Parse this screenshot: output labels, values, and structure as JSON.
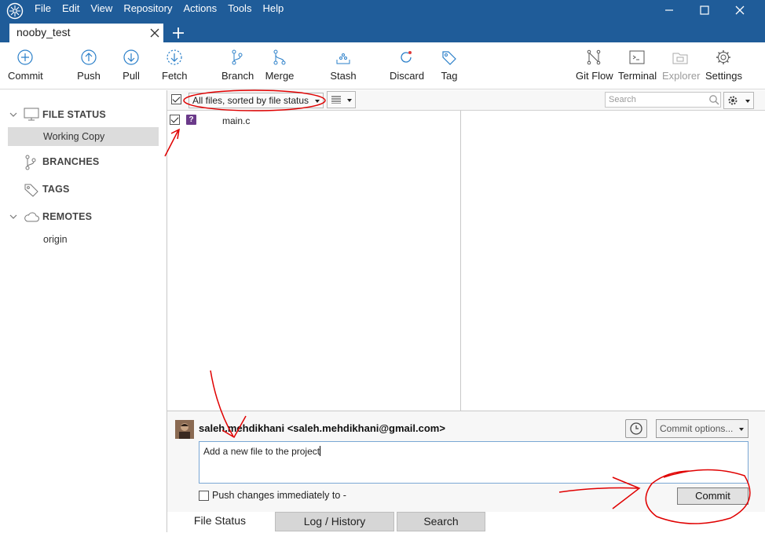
{
  "menu": [
    "File",
    "Edit",
    "View",
    "Repository",
    "Actions",
    "Tools",
    "Help"
  ],
  "tab": {
    "label": "nooby_test"
  },
  "toolbar": {
    "commit": "Commit",
    "push": "Push",
    "pull": "Pull",
    "fetch": "Fetch",
    "branch": "Branch",
    "merge": "Merge",
    "stash": "Stash",
    "discard": "Discard",
    "tag": "Tag",
    "gitflow": "Git Flow",
    "terminal": "Terminal",
    "explorer": "Explorer",
    "settings": "Settings"
  },
  "sidebar": {
    "file_status": "FILE STATUS",
    "working_copy": "Working Copy",
    "branches": "BRANCHES",
    "tags": "TAGS",
    "remotes": "REMOTES",
    "origin": "origin"
  },
  "filter": {
    "sort": "All files, sorted by file status",
    "search_placeholder": "Search"
  },
  "files": [
    {
      "name": "main.c",
      "status": "?"
    }
  ],
  "commit": {
    "author": "saleh.mehdikhani <saleh.mehdikhani@gmail.com>",
    "options": "Commit options...",
    "message": "Add a new file to the project",
    "push_label": "Push changes immediately to -",
    "button": "Commit"
  },
  "bottom_tabs": {
    "file_status": "File Status",
    "log": "Log / History",
    "search": "Search"
  },
  "colors": {
    "titlebar": "#1f5c99",
    "annotation": "#e00000"
  }
}
